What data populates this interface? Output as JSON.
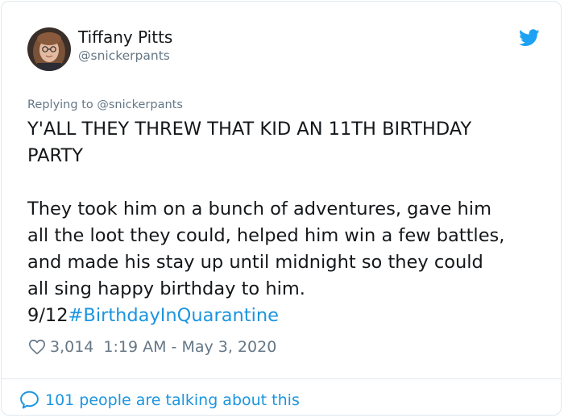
{
  "author": {
    "name": "Tiffany Pitts",
    "handle": "@snickerpants"
  },
  "reply_to": "Replying to @snickerpants",
  "tweet": {
    "line1": "Y'ALL THEY THREW THAT KID AN 11TH BIRTHDAY",
    "line2": "PARTY",
    "para_line1": "They took him on a bunch of adventures, gave him",
    "para_line2": "all the loot they could, helped him win a few battles,",
    "para_line3": "and made his stay up until midnight so they could",
    "para_line4": "all sing happy birthday to him.",
    "counter": "9/12",
    "hashtag": "#BirthdayInQuarantine"
  },
  "meta": {
    "likes": "3,014",
    "timestamp": "1:19 AM - May 3, 2020"
  },
  "footer": {
    "talking": "101 people are talking about this"
  },
  "colors": {
    "accent": "#1b95e0",
    "muted": "#657786",
    "text": "#14171a",
    "border": "#e1e8ed"
  },
  "icons": [
    "twitter-bird-icon",
    "heart-icon",
    "speech-bubble-icon"
  ]
}
